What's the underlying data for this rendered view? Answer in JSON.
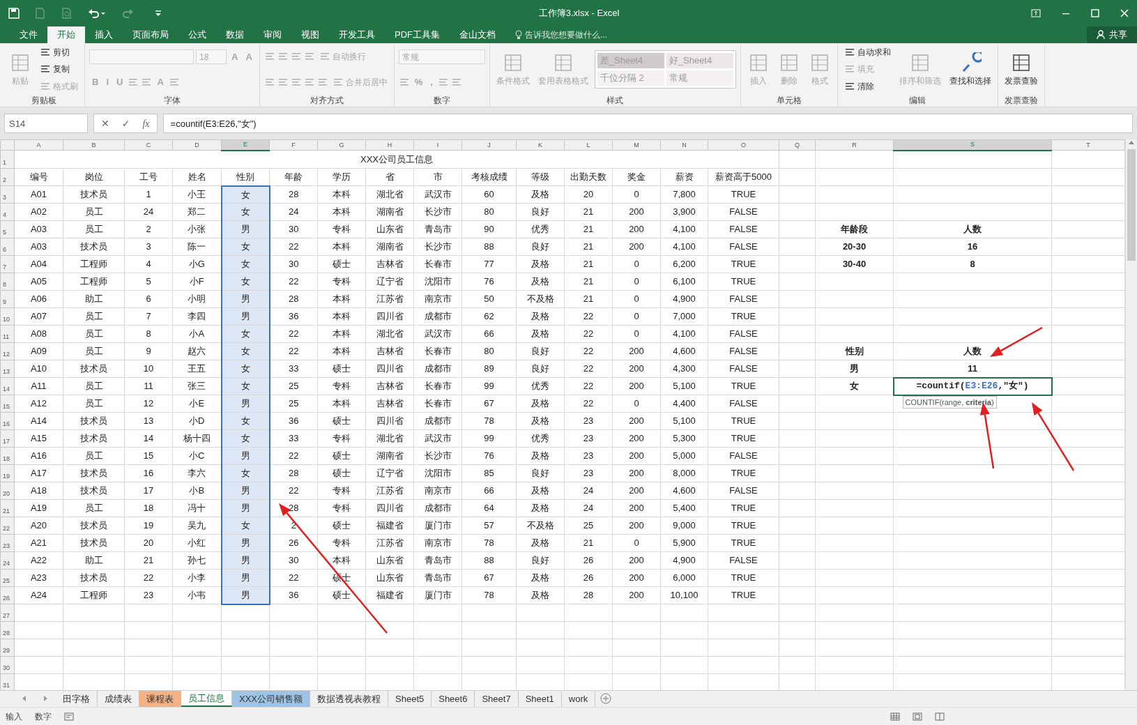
{
  "window": {
    "title": "工作簿3.xlsx - Excel"
  },
  "ribbon_tabs": [
    {
      "label": "文件",
      "selected": false
    },
    {
      "label": "开始",
      "selected": true
    },
    {
      "label": "插入",
      "selected": false
    },
    {
      "label": "页面布局",
      "selected": false
    },
    {
      "label": "公式",
      "selected": false
    },
    {
      "label": "数据",
      "selected": false
    },
    {
      "label": "审阅",
      "selected": false
    },
    {
      "label": "视图",
      "selected": false
    },
    {
      "label": "开发工具",
      "selected": false
    },
    {
      "label": "PDF工具集",
      "selected": false
    },
    {
      "label": "金山文档",
      "selected": false
    }
  ],
  "tell_me": {
    "placeholder": "告诉我您想要做什么..."
  },
  "share": "共享",
  "ribbon_groups": [
    {
      "label": "剪贴板",
      "columns": [
        [
          [
            {
              "kind": "large",
              "label": "粘贴",
              "disabled": true
            }
          ]
        ],
        [
          [
            {
              "kind": "small",
              "label": "剪切",
              "disabled": false
            }
          ],
          [
            {
              "kind": "small",
              "label": "复制",
              "disabled": false
            }
          ],
          [
            {
              "kind": "small",
              "label": "格式刷",
              "disabled": true
            }
          ]
        ]
      ]
    },
    {
      "label": "字体",
      "columns": [
        [
          [
            {
              "kind": "font-field",
              "disabled": true
            },
            {
              "kind": "size-field",
              "value": "18",
              "disabled": true
            },
            {
              "kind": "glyph",
              "label": "A",
              "disabled": true
            },
            {
              "kind": "glyph",
              "label": "A",
              "disabled": true
            }
          ],
          [
            {
              "kind": "glyph",
              "label": "B",
              "disabled": true
            },
            {
              "kind": "glyph",
              "label": "I",
              "disabled": true
            },
            {
              "kind": "glyph",
              "label": "U",
              "disabled": true
            },
            {
              "kind": "icon",
              "disabled": true
            },
            {
              "kind": "icon",
              "disabled": true
            },
            {
              "kind": "glyph",
              "label": "A",
              "disabled": true
            },
            {
              "kind": "icon",
              "disabled": true
            }
          ]
        ]
      ]
    },
    {
      "label": "对齐方式",
      "columns": [
        [
          [
            {
              "kind": "icon",
              "disabled": true
            },
            {
              "kind": "icon",
              "disabled": true
            },
            {
              "kind": "icon",
              "disabled": true
            },
            {
              "kind": "icon",
              "disabled": true
            },
            {
              "kind": "small",
              "label": "自动换行",
              "disabled": true
            }
          ],
          [
            {
              "kind": "icon",
              "disabled": true
            },
            {
              "kind": "icon",
              "disabled": true
            },
            {
              "kind": "icon",
              "disabled": true
            },
            {
              "kind": "icon",
              "disabled": true
            },
            {
              "kind": "icon",
              "disabled": true
            },
            {
              "kind": "small",
              "label": "合并后居中",
              "disabled": true
            }
          ]
        ]
      ]
    },
    {
      "label": "数字",
      "columns": [
        [
          [
            {
              "kind": "number-field",
              "value": "常规",
              "disabled": true
            }
          ],
          [
            {
              "kind": "icon",
              "disabled": true
            },
            {
              "kind": "glyph",
              "label": "%",
              "disabled": true
            },
            {
              "kind": "glyph",
              "label": ",",
              "disabled": true
            },
            {
              "kind": "icon",
              "disabled": true
            },
            {
              "kind": "icon",
              "disabled": true
            }
          ]
        ]
      ]
    },
    {
      "label": "样式",
      "columns": [
        [
          [
            {
              "kind": "large",
              "label": "条件格式",
              "disabled": true
            }
          ]
        ],
        [
          [
            {
              "kind": "large",
              "label": "套用表格格式",
              "disabled": true
            }
          ]
        ],
        [
          [
            {
              "kind": "gallery",
              "styles": [
                {
                  "label": "差_Sheet4",
                  "color": "#cfcbcf"
                },
                {
                  "label": "好_Sheet4",
                  "color": "#ebe6ea"
                },
                {
                  "label": "千位分隔 2",
                  "color": "#f4f0f4"
                },
                {
                  "label": "常规",
                  "color": "#f4f0f4"
                }
              ]
            }
          ]
        ]
      ]
    },
    {
      "label": "单元格",
      "columns": [
        [
          [
            {
              "kind": "large",
              "label": "插入",
              "disabled": true
            }
          ]
        ],
        [
          [
            {
              "kind": "large",
              "label": "删除",
              "disabled": true
            }
          ]
        ],
        [
          [
            {
              "kind": "large",
              "label": "格式",
              "disabled": true
            }
          ]
        ]
      ]
    },
    {
      "label": "编辑",
      "columns": [
        [
          [
            {
              "kind": "small",
              "label": "自动求和",
              "disabled": false
            }
          ],
          [
            {
              "kind": "small",
              "label": "填充",
              "disabled": true
            }
          ],
          [
            {
              "kind": "small",
              "label": "清除",
              "disabled": false
            }
          ]
        ],
        [
          [
            {
              "kind": "large",
              "label": "排序和筛选",
              "disabled": true
            }
          ]
        ],
        [
          [
            {
              "kind": "large",
              "label": "查找和选择",
              "disabled": false
            }
          ]
        ]
      ]
    },
    {
      "label": "发票查验",
      "columns": [
        [
          [
            {
              "kind": "large",
              "label": "发票查验",
              "disabled": false
            }
          ]
        ]
      ]
    }
  ],
  "formula_bar": {
    "name_box": "S14",
    "cancel": "✕",
    "enter": "✓",
    "function": "fx",
    "formula": "=countif(E3:E26,\"女\")"
  },
  "columns": [
    {
      "letter": "A",
      "selected": false,
      "in_range": false
    },
    {
      "letter": "B",
      "selected": false,
      "in_range": false
    },
    {
      "letter": "C",
      "selected": false,
      "in_range": false
    },
    {
      "letter": "D",
      "selected": false,
      "in_range": false
    },
    {
      "letter": "E",
      "selected": true,
      "in_range": true
    },
    {
      "letter": "F",
      "selected": false,
      "in_range": false
    },
    {
      "letter": "G",
      "selected": false,
      "in_range": false
    },
    {
      "letter": "H",
      "selected": false,
      "in_range": false
    },
    {
      "letter": "I",
      "selected": false,
      "in_range": false
    },
    {
      "letter": "J",
      "selected": false,
      "in_range": false
    },
    {
      "letter": "K",
      "selected": false,
      "in_range": false
    },
    {
      "letter": "L",
      "selected": false,
      "in_range": false
    },
    {
      "letter": "M",
      "selected": false,
      "in_range": false
    },
    {
      "letter": "N",
      "selected": false,
      "in_range": false
    },
    {
      "letter": "O",
      "selected": false,
      "in_range": false
    },
    {
      "letter": "Q",
      "selected": false,
      "in_range": false
    },
    {
      "letter": "R",
      "selected": false,
      "in_range": false
    },
    {
      "letter": "S",
      "selected": true,
      "in_range": false
    },
    {
      "letter": "T",
      "selected": false,
      "in_range": false
    }
  ],
  "rows": [
    {
      "n": "1",
      "title": "XXX公司员工信息"
    },
    {
      "n": "2",
      "cells": [
        "编号",
        "岗位",
        "工号",
        "姓名",
        "性别",
        "年龄",
        "学历",
        "省",
        "市",
        "考核成绩",
        "等级",
        "出勤天数",
        "奖金",
        "薪资",
        "薪资高于5000"
      ]
    },
    {
      "n": "3",
      "range": true,
      "cells": [
        "A01",
        "技术员",
        "1",
        "小王",
        "女",
        "28",
        "本科",
        "湖北省",
        "武汉市",
        "60",
        "及格",
        "20",
        "0",
        "7,800",
        "TRUE"
      ]
    },
    {
      "n": "4",
      "range": true,
      "cells": [
        "A02",
        "员工",
        "24",
        "郑二",
        "女",
        "24",
        "本科",
        "湖南省",
        "长沙市",
        "80",
        "良好",
        "21",
        "200",
        "3,900",
        "FALSE"
      ]
    },
    {
      "n": "5",
      "range": true,
      "cells": [
        "A03",
        "员工",
        "2",
        "小张",
        "男",
        "30",
        "专科",
        "山东省",
        "青岛市",
        "90",
        "优秀",
        "21",
        "200",
        "4,100",
        "FALSE"
      ],
      "side": [
        "年龄段",
        "人数"
      ]
    },
    {
      "n": "6",
      "range": true,
      "cells": [
        "A03",
        "技术员",
        "3",
        "陈一",
        "女",
        "22",
        "本科",
        "湖南省",
        "长沙市",
        "88",
        "良好",
        "21",
        "200",
        "4,100",
        "FALSE"
      ],
      "side": [
        "20-30",
        "16"
      ]
    },
    {
      "n": "7",
      "range": true,
      "cells": [
        "A04",
        "工程师",
        "4",
        "小G",
        "女",
        "30",
        "硕士",
        "吉林省",
        "长春市",
        "77",
        "及格",
        "21",
        "0",
        "6,200",
        "TRUE"
      ],
      "side": [
        "30-40",
        "8"
      ]
    },
    {
      "n": "8",
      "range": true,
      "cells": [
        "A05",
        "工程师",
        "5",
        "小F",
        "女",
        "22",
        "专科",
        "辽宁省",
        "沈阳市",
        "76",
        "及格",
        "21",
        "0",
        "6,100",
        "TRUE"
      ]
    },
    {
      "n": "9",
      "range": true,
      "cells": [
        "A06",
        "助工",
        "6",
        "小明",
        "男",
        "28",
        "本科",
        "江苏省",
        "南京市",
        "50",
        "不及格",
        "21",
        "0",
        "4,900",
        "FALSE"
      ]
    },
    {
      "n": "10",
      "range": true,
      "cells": [
        "A07",
        "员工",
        "7",
        "李四",
        "男",
        "36",
        "本科",
        "四川省",
        "成都市",
        "62",
        "及格",
        "22",
        "0",
        "7,000",
        "TRUE"
      ]
    },
    {
      "n": "11",
      "range": true,
      "cells": [
        "A08",
        "员工",
        "8",
        "小A",
        "女",
        "22",
        "本科",
        "湖北省",
        "武汉市",
        "66",
        "及格",
        "22",
        "0",
        "4,100",
        "FALSE"
      ]
    },
    {
      "n": "12",
      "range": true,
      "cells": [
        "A09",
        "员工",
        "9",
        "赵六",
        "女",
        "22",
        "本科",
        "吉林省",
        "长春市",
        "80",
        "良好",
        "22",
        "200",
        "4,600",
        "FALSE"
      ],
      "side": [
        "性别",
        "人数"
      ]
    },
    {
      "n": "13",
      "range": true,
      "cells": [
        "A10",
        "技术员",
        "10",
        "王五",
        "女",
        "33",
        "硕士",
        "四川省",
        "成都市",
        "89",
        "良好",
        "22",
        "200",
        "4,300",
        "FALSE"
      ],
      "side": [
        "男",
        "11"
      ]
    },
    {
      "n": "14",
      "range": true,
      "cells": [
        "A11",
        "员工",
        "11",
        "张三",
        "女",
        "25",
        "专科",
        "吉林省",
        "长春市",
        "99",
        "优秀",
        "22",
        "200",
        "5,100",
        "TRUE"
      ],
      "side": [
        "女"
      ],
      "edit": {
        "parts": [
          {
            "text": "=countif(",
            "ref": false
          },
          {
            "text": "E3:E26",
            "ref": true
          },
          {
            "text": ",\"女\")",
            "ref": false
          }
        ],
        "tooltip": "COUNTIF(range, **criteria**)"
      }
    },
    {
      "n": "15",
      "range": true,
      "cells": [
        "A12",
        "员工",
        "12",
        "小E",
        "男",
        "25",
        "本科",
        "吉林省",
        "长春市",
        "67",
        "及格",
        "22",
        "0",
        "4,400",
        "FALSE"
      ]
    },
    {
      "n": "16",
      "range": true,
      "cells": [
        "A14",
        "技术员",
        "13",
        "小D",
        "女",
        "36",
        "硕士",
        "四川省",
        "成都市",
        "78",
        "及格",
        "23",
        "200",
        "5,100",
        "TRUE"
      ]
    },
    {
      "n": "17",
      "range": true,
      "cells": [
        "A15",
        "技术员",
        "14",
        "杨十四",
        "女",
        "33",
        "专科",
        "湖北省",
        "武汉市",
        "99",
        "优秀",
        "23",
        "200",
        "5,300",
        "TRUE"
      ]
    },
    {
      "n": "18",
      "range": true,
      "cells": [
        "A16",
        "员工",
        "15",
        "小C",
        "男",
        "22",
        "硕士",
        "湖南省",
        "长沙市",
        "76",
        "及格",
        "23",
        "200",
        "5,000",
        "FALSE"
      ]
    },
    {
      "n": "19",
      "range": true,
      "cells": [
        "A17",
        "技术员",
        "16",
        "李六",
        "女",
        "28",
        "硕士",
        "辽宁省",
        "沈阳市",
        "85",
        "良好",
        "23",
        "200",
        "8,000",
        "TRUE"
      ]
    },
    {
      "n": "20",
      "range": true,
      "cells": [
        "A18",
        "技术员",
        "17",
        "小B",
        "男",
        "22",
        "专科",
        "江苏省",
        "南京市",
        "66",
        "及格",
        "24",
        "200",
        "4,600",
        "FALSE"
      ]
    },
    {
      "n": "21",
      "range": true,
      "cells": [
        "A19",
        "员工",
        "18",
        "冯十",
        "男",
        "28",
        "专科",
        "四川省",
        "成都市",
        "64",
        "及格",
        "24",
        "200",
        "5,400",
        "TRUE"
      ]
    },
    {
      "n": "22",
      "range": true,
      "cells": [
        "A20",
        "技术员",
        "19",
        "吴九",
        "女",
        "2",
        "硕士",
        "福建省",
        "厦门市",
        "57",
        "不及格",
        "25",
        "200",
        "9,000",
        "TRUE"
      ]
    },
    {
      "n": "23",
      "range": true,
      "cells": [
        "A21",
        "技术员",
        "20",
        "小红",
        "男",
        "26",
        "专科",
        "江苏省",
        "南京市",
        "78",
        "及格",
        "21",
        "0",
        "5,900",
        "TRUE"
      ]
    },
    {
      "n": "24",
      "range": true,
      "cells": [
        "A22",
        "助工",
        "21",
        "孙七",
        "男",
        "30",
        "本科",
        "山东省",
        "青岛市",
        "88",
        "良好",
        "26",
        "200",
        "4,900",
        "FALSE"
      ]
    },
    {
      "n": "25",
      "range": true,
      "cells": [
        "A23",
        "技术员",
        "22",
        "小李",
        "男",
        "22",
        "硕士",
        "山东省",
        "青岛市",
        "67",
        "及格",
        "26",
        "200",
        "6,000",
        "TRUE"
      ]
    },
    {
      "n": "26",
      "range": true,
      "cells": [
        "A24",
        "工程师",
        "23",
        "小韦",
        "男",
        "36",
        "硕士",
        "福建省",
        "厦门市",
        "78",
        "及格",
        "28",
        "200",
        "10,100",
        "TRUE"
      ]
    },
    {
      "n": "27"
    },
    {
      "n": "28"
    },
    {
      "n": "29"
    },
    {
      "n": "30"
    },
    {
      "n": "31"
    }
  ],
  "sheet_tabs": [
    {
      "label": "田字格",
      "selected": false
    },
    {
      "label": "成绩表",
      "selected": false
    },
    {
      "label": "课程表",
      "selected": false,
      "color": "#f4b183"
    },
    {
      "label": "员工信息",
      "selected": true
    },
    {
      "label": "XXX公司销售额",
      "selected": false,
      "color": "#9dc3e6"
    },
    {
      "label": "数据透视表教程",
      "selected": false
    },
    {
      "label": "Sheet5",
      "selected": false
    },
    {
      "label": "Sheet6",
      "selected": false
    },
    {
      "label": "Sheet7",
      "selected": false
    },
    {
      "label": "Sheet1",
      "selected": false
    },
    {
      "label": "work",
      "selected": false
    }
  ],
  "status_bar": {
    "items": [
      "输入",
      "数字"
    ]
  }
}
